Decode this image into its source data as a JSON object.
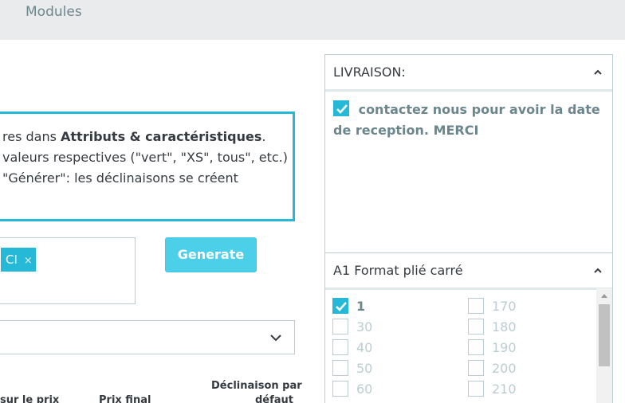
{
  "topbar": {
    "modules_label": "Modules"
  },
  "info": {
    "line1_pre": "res dans ",
    "line1_bold": "Attributs & caractéristiques",
    "line1_post": ".",
    "line2": "valeurs respectives (\"vert\", \"XS\", tous\", etc.)",
    "line3": "\"Générer\": les déclinaisons se créent"
  },
  "tag_field": {
    "tag_label": "CI",
    "remove_glyph": "×"
  },
  "generate_label": "Generate",
  "select": {
    "chevron_icon": "chevron-down-icon"
  },
  "table_headers": {
    "col_partial": "sur le prix",
    "col_final": "Prix final",
    "col_default_l1": "Déclinaison par",
    "col_default_l2": "défaut"
  },
  "livraison": {
    "title": "LIVRAISON:",
    "option_text": "contactez nous pour avoir la date de reception. MERCI",
    "checked": true
  },
  "format": {
    "title": "A1 Format plié carré",
    "left_options": [
      {
        "label": "1",
        "checked": true
      },
      {
        "label": "30",
        "checked": false
      },
      {
        "label": "40",
        "checked": false
      },
      {
        "label": "50",
        "checked": false
      },
      {
        "label": "60",
        "checked": false
      }
    ],
    "right_options": [
      {
        "label": "170",
        "checked": false
      },
      {
        "label": "180",
        "checked": false
      },
      {
        "label": "190",
        "checked": false
      },
      {
        "label": "200",
        "checked": false
      },
      {
        "label": "210",
        "checked": false
      }
    ]
  },
  "colors": {
    "accent": "#25b9d7",
    "button": "#4cd0ea",
    "muted_text": "#6c868e",
    "border": "#bbcdd2"
  }
}
